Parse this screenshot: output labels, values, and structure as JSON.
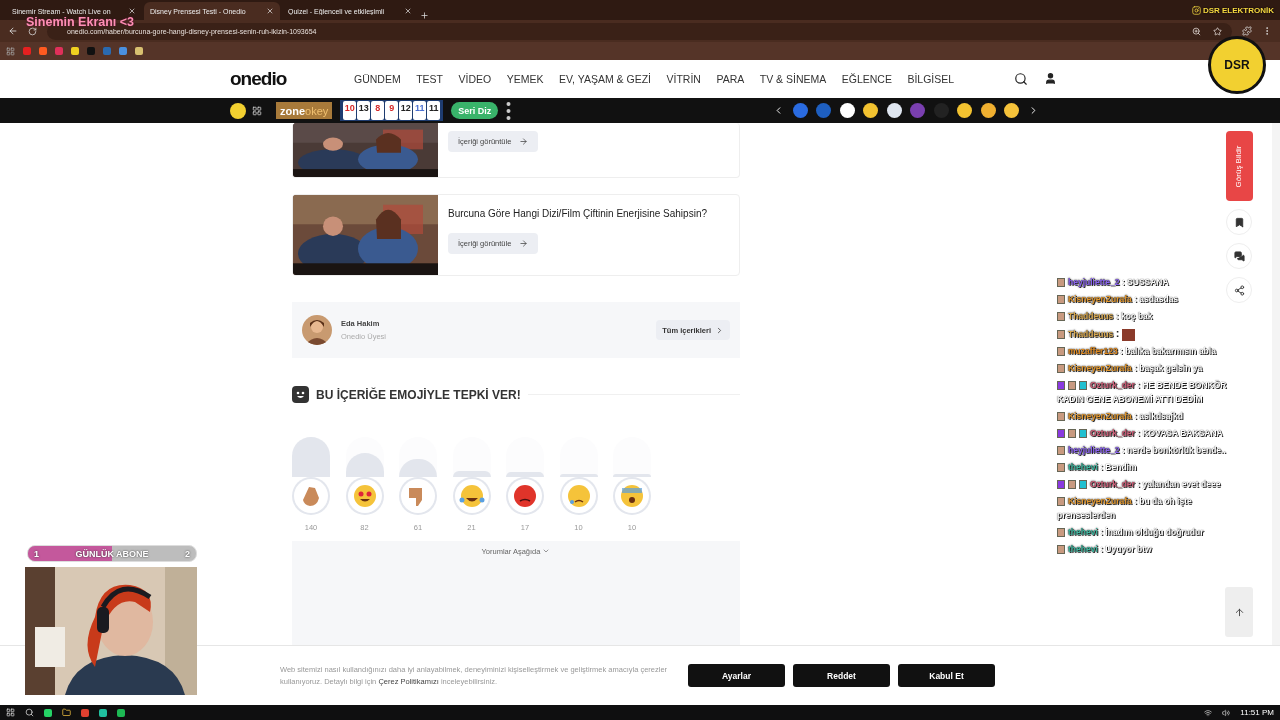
{
  "browser": {
    "tabs": [
      {
        "title": "Sinemir Stream - Watch Live on",
        "selected": false
      },
      {
        "title": "Disney Prensesi Testi - Onedio",
        "selected": true
      },
      {
        "title": "Quizei - Eğlenceli ve etkileşimli",
        "selected": false
      }
    ],
    "url": "onedio.com/haber/burcuna-gore-hangi-disney-prensesi-senin-ruh-ikizin-1093654"
  },
  "site": {
    "logo": "onedio",
    "nav": [
      "GÜNDEM",
      "TEST",
      "VİDEO",
      "YEMEK",
      "EV, YAŞAM & GEZİ",
      "VİTRİN",
      "PARA",
      "TV & SİNEMA",
      "EĞLENCE",
      "BİLGİSEL"
    ]
  },
  "ad_bar": {
    "brand_a": "zone",
    "brand_b": "okey",
    "tiles": [
      {
        "number": "10",
        "color": "#d42a2a"
      },
      {
        "number": "13",
        "color": "#222222"
      },
      {
        "number": "8",
        "color": "#d42a2a"
      },
      {
        "number": "9",
        "color": "#d42a2a"
      },
      {
        "number": "12",
        "color": "#222222"
      },
      {
        "number": "11",
        "color": "#4a6fd0"
      },
      {
        "number": "11",
        "color": "#222222"
      }
    ],
    "button": "Seri Diz",
    "categories": [
      {
        "color": "#2a6be0"
      },
      {
        "color": "#1e5fc0"
      },
      {
        "color": "#ffffff"
      },
      {
        "color": "#f2c230"
      },
      {
        "color": "#dfe6f0"
      },
      {
        "color": "#7a3fb0"
      },
      {
        "color": "#222222"
      },
      {
        "color": "#f2c230"
      },
      {
        "color": "#f0b030"
      },
      {
        "color": "#f5c23a"
      }
    ]
  },
  "cards": [
    {
      "button": "İçeriği görüntüle"
    },
    {
      "title": "Burcuna Göre Hangi Dizi/Film Çiftinin Enerjisine Sahipsin?",
      "button": "İçeriği görüntüle"
    }
  ],
  "author": {
    "name": "Eda Hakim",
    "role": "Onedio Üyesi",
    "button": "Tüm içerikleri"
  },
  "reactions": {
    "heading": "BU İÇERİĞE EMOJİYLE TEPKİ VER!",
    "items": [
      {
        "kind": "clap",
        "count": "140",
        "level": 1
      },
      {
        "kind": "love",
        "count": "82",
        "level": 0.59
      },
      {
        "kind": "dislike",
        "count": "61",
        "level": 0.44
      },
      {
        "kind": "laugh",
        "count": "21",
        "level": 0.15
      },
      {
        "kind": "angry",
        "count": "17",
        "level": 0.12
      },
      {
        "kind": "sad",
        "count": "10",
        "level": 0.07
      },
      {
        "kind": "scared",
        "count": "10",
        "level": 0.07
      }
    ]
  },
  "comments_toggle": "Yorumlar Aşağıda",
  "feedback_button": "Görüş Bildir",
  "cookie": {
    "before": "Web sitemizi nasıl kullandığınızı daha iyi anlayabilmek, deneyiminizi kişiselleştirmek ve geliştirmek amacıyla çerezler kullanıyoruz. Detaylı bilgi için",
    "link": "Çerez Politikamızı",
    "after": "inceleyebilirsiniz.",
    "buttons": [
      "Ayarlar",
      "Reddet",
      "Kabul Et"
    ]
  },
  "overlay": {
    "title": "Sinemin Ekranı <3",
    "sponsor": "DSR ELEKTRONİK",
    "sponsor_logo": "DSR",
    "sub_goal": {
      "current": "1",
      "label": "GÜNLÜK ABONE",
      "target": "2",
      "level": 0.5
    },
    "chat": [
      {
        "user": "heyjuliette_2",
        "color": "#8a62f0",
        "message": ": SUSSANA",
        "sub": false,
        "emote": false
      },
      {
        "user": "KisneyenZurafa",
        "color": "#e0962e",
        "message": ": asdasdas",
        "sub": false,
        "emote": false
      },
      {
        "user": "Thaddeuus",
        "color": "#d8a850",
        "message": ": koç bak",
        "sub": false,
        "emote": false
      },
      {
        "user": "Thaddeuus",
        "color": "#d8a850",
        "message": ":",
        "sub": false,
        "emote": true
      },
      {
        "user": "muzaffer123",
        "color": "#e08a20",
        "message": ": balıka bakarmısın abla",
        "sub": false,
        "emote": false
      },
      {
        "user": "KisneyenZurafa",
        "color": "#e0962e",
        "message": ": başak gelsin ya",
        "sub": false,
        "emote": false
      },
      {
        "user": "Ozturk_der",
        "color": "#d0607a",
        "message": ": HE BENDE BONKÖR KADIN GENE ABONEMİ ATTI DEDİM",
        "sub": true,
        "emote": false
      },
      {
        "user": "KisneyenZurafa",
        "color": "#e0962e",
        "message": ": aslkdsajkd",
        "sub": false,
        "emote": false
      },
      {
        "user": "Ozturk_der",
        "color": "#d0607a",
        "message": ": KOVASA BAKSANA",
        "sub": true,
        "emote": false
      },
      {
        "user": "heyjuliette_2",
        "color": "#8a62f0",
        "message": ": nerde bonkörlük bende..",
        "sub": false,
        "emote": false
      },
      {
        "user": "thehevi",
        "color": "#3fb8a0",
        "message": ": Bendim",
        "sub": false,
        "emote": false
      },
      {
        "user": "Ozturk_der",
        "color": "#d0607a",
        "message": ": yalandan evet deee",
        "sub": true,
        "emote": false
      },
      {
        "user": "KisneyenZurafa",
        "color": "#e0962e",
        "message": ": bu da oh işte prenseslerden",
        "sub": false,
        "emote": false
      },
      {
        "user": "thehevi",
        "color": "#3fb8a0",
        "message": ": İnadım olduğu doğrudur",
        "sub": false,
        "emote": false
      },
      {
        "user": "thehevi",
        "color": "#3fb8a0",
        "message": ": Uyuyor btw",
        "sub": false,
        "emote": false
      }
    ]
  },
  "taskbar": {
    "time": "11:51 PM"
  }
}
